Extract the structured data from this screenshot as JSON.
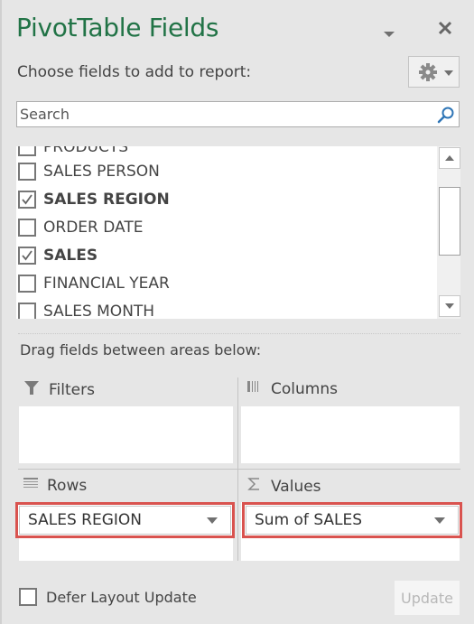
{
  "panel": {
    "title": "PivotTable Fields",
    "menu_icon": "dropdown-arrow-icon",
    "close_icon": "close-icon"
  },
  "fields_section": {
    "label": "Choose fields to add to report:",
    "tools_button_icon": "gear-icon",
    "search": {
      "placeholder": "Search",
      "value": "",
      "icon": "search-icon"
    },
    "fields": [
      {
        "label": "PRODUCTS",
        "checked": false,
        "partial": true
      },
      {
        "label": "SALES PERSON",
        "checked": false
      },
      {
        "label": "SALES REGION",
        "checked": true
      },
      {
        "label": "ORDER DATE",
        "checked": false
      },
      {
        "label": "SALES",
        "checked": true
      },
      {
        "label": "FINANCIAL YEAR",
        "checked": false
      },
      {
        "label": "SALES MONTH",
        "checked": false
      }
    ]
  },
  "areas_section": {
    "label": "Drag fields between areas below:",
    "filters": {
      "label": "Filters",
      "icon": "filter-icon",
      "items": []
    },
    "columns": {
      "label": "Columns",
      "icon": "columns-icon",
      "items": []
    },
    "rows": {
      "label": "Rows",
      "icon": "rows-icon",
      "items": [
        "SALES REGION"
      ]
    },
    "values": {
      "label": "Values",
      "icon": "sigma-icon",
      "items": [
        "Sum of SALES"
      ]
    },
    "highlight_color": "#d9534f"
  },
  "footer": {
    "defer_label": "Defer Layout Update",
    "defer_checked": false,
    "update_label": "Update",
    "update_enabled": false
  },
  "colors": {
    "title": "#217346",
    "background": "#e6e6e6",
    "search_icon": "#2e75b6"
  }
}
